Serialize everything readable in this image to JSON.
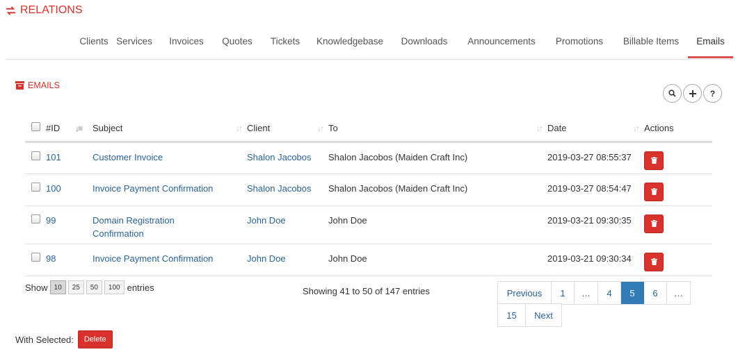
{
  "header": {
    "title": "RELATIONS",
    "icon": "exchange-icon"
  },
  "tabs": [
    {
      "label": "Clients"
    },
    {
      "label": "Services"
    },
    {
      "label": "Invoices"
    },
    {
      "label": "Quotes"
    },
    {
      "label": "Tickets"
    },
    {
      "label": "Knowledgebase"
    },
    {
      "label": "Downloads"
    },
    {
      "label": "Announcements"
    },
    {
      "label": "Promotions"
    },
    {
      "label": "Billable Items"
    },
    {
      "label": "Emails",
      "active": true
    }
  ],
  "section": {
    "title": "EMAILS",
    "icon": "archive-icon"
  },
  "toolbar": {
    "search_icon": "search-icon",
    "add_icon": "plus-icon",
    "help_label": "?"
  },
  "table": {
    "columns": {
      "id": "#ID",
      "subject": "Subject",
      "client": "Client",
      "to": "To",
      "date": "Date",
      "actions": "Actions"
    },
    "rows": [
      {
        "id": "101",
        "subject": "Customer Invoice",
        "client": "Shalon Jacobos",
        "to": "Shalon Jacobos (Maiden Craft Inc)",
        "date": "2019-03-27 08:55:37"
      },
      {
        "id": "100",
        "subject": "Invoice Payment Confirmation",
        "client": "Shalon Jacobos",
        "to": "Shalon Jacobos (Maiden Craft Inc)",
        "date": "2019-03-27 08:54:47"
      },
      {
        "id": "99",
        "subject": "Domain Registration Confirmation",
        "client": "John Doe",
        "to": "John Doe",
        "date": "2019-03-21 09:30:35"
      },
      {
        "id": "98",
        "subject": "Invoice Payment Confirmation",
        "client": "John Doe",
        "to": "John Doe",
        "date": "2019-03-21 09:30:34"
      }
    ]
  },
  "length": {
    "show_label": "Show",
    "options": [
      "10",
      "25",
      "50",
      "100"
    ],
    "selected": "10",
    "entries_label": "entries"
  },
  "info": {
    "text": "Showing 41 to 50 of 147 entries"
  },
  "pagination": {
    "previous": "Previous",
    "pages": [
      "1",
      "…",
      "4",
      "5",
      "6",
      "…"
    ],
    "current": "5",
    "last": "15",
    "next": "Next"
  },
  "footer": {
    "with_selected": "With Selected:",
    "delete_label": "Delete"
  },
  "colors": {
    "accent": "#d9312b",
    "link": "#2a6496",
    "active_page": "#337ab7"
  }
}
